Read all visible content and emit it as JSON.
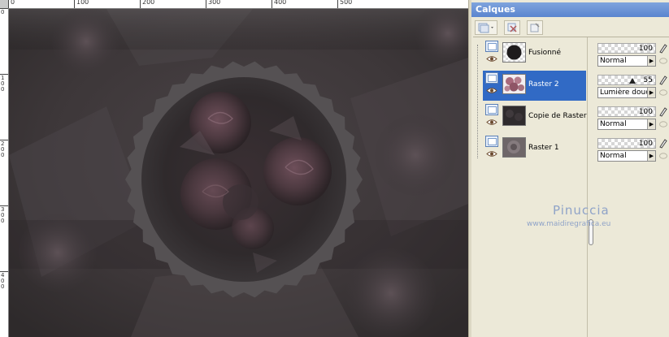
{
  "rulers": {
    "top_labels": [
      "0",
      "100",
      "200",
      "300",
      "400",
      "500"
    ],
    "left_labels": [
      "0",
      "100",
      "200",
      "300",
      "400"
    ]
  },
  "palette": {
    "title": "Calques",
    "layers": [
      {
        "name": "Fusionné",
        "opacity": "100",
        "blend": "Normal",
        "selected": false,
        "thumb": "dark-circle"
      },
      {
        "name": "Raster 2",
        "opacity": "55",
        "blend": "Lumière douce",
        "selected": true,
        "thumb": "roses"
      },
      {
        "name": "Copie de Raster",
        "opacity": "100",
        "blend": "Normal",
        "selected": false,
        "thumb": "dark-texture"
      },
      {
        "name": "Raster 1",
        "opacity": "100",
        "blend": "Normal",
        "selected": false,
        "thumb": "blur"
      }
    ]
  },
  "watermark": {
    "name": "Pinuccia",
    "url": "www.maidiregrafica.eu"
  },
  "colors": {
    "selection": "#316ac5",
    "title_bar": "#6b93d6",
    "canvas_dark": "#3a3436"
  }
}
